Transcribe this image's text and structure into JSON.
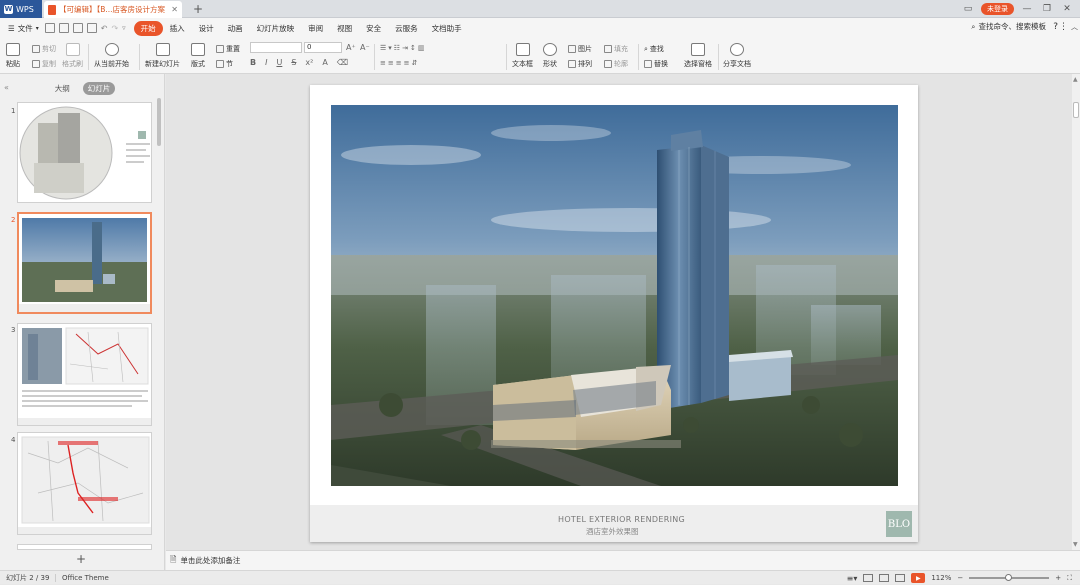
{
  "titlebar": {
    "app_name": "WPS",
    "doc_tab": "【可编辑】【B...店客房设计方案",
    "login_label": "未登录"
  },
  "menubar": {
    "file_label": "文件",
    "items": [
      "开始",
      "插入",
      "设计",
      "动画",
      "幻灯片放映",
      "审阅",
      "视图",
      "安全",
      "云服务",
      "文档助手"
    ],
    "active_index": 0,
    "search_label": "查找命令、搜索模板"
  },
  "ribbon": {
    "paste": "粘贴",
    "cut": "剪切",
    "copy": "复制",
    "format_painter": "格式刷",
    "play_from_current": "从当前开始",
    "new_slide": "新建幻灯片",
    "layout": "版式",
    "reset": "重置",
    "section": "节",
    "font_size": "0",
    "textbox": "文本框",
    "shape": "形状",
    "picture": "图片",
    "fill": "填充",
    "arrange": "排列",
    "outline": "轮廓",
    "find": "查找",
    "replace": "替换",
    "selection_pane": "选择窗格",
    "share": "分享文档"
  },
  "left_panel": {
    "tab_outline": "大纲",
    "tab_slides": "幻灯片",
    "slide_numbers": [
      "1",
      "2",
      "3",
      "4"
    ],
    "selected": 1
  },
  "slide": {
    "footer_en": "HOTEL EXTERIOR RENDERING",
    "footer_cn": "酒店室外效果图",
    "logo": "BLO"
  },
  "notes_placeholder": "单击此处添加备注",
  "status": {
    "slide_info": "幻灯片 2 / 39",
    "theme": "Office Theme",
    "zoom": "112%"
  },
  "colors": {
    "accent": "#e9542a",
    "brand_blue": "#2b579a",
    "logo_green": "#9fb8ae"
  }
}
